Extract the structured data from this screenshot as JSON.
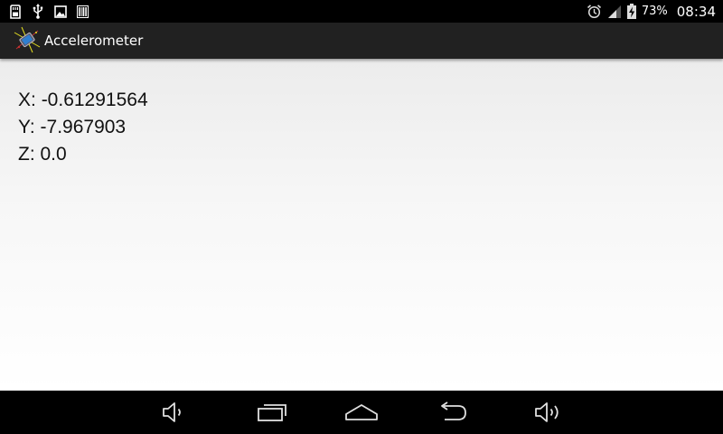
{
  "status_bar": {
    "left_icons": [
      "sd-card-icon",
      "usb-icon",
      "image-icon",
      "barcode-icon"
    ],
    "battery_percent": "73%",
    "time": "08:34"
  },
  "app": {
    "title": "Accelerometer"
  },
  "readings": [
    {
      "label": "X: ",
      "value": "-0.61291564"
    },
    {
      "label": "Y: ",
      "value": "-7.967903"
    },
    {
      "label": "Z: ",
      "value": "0.0"
    }
  ],
  "navigation": {
    "buttons": [
      "volume-down",
      "recent-apps",
      "home",
      "back",
      "volume-up"
    ]
  },
  "colors": {
    "status_bar": "#000000",
    "action_bar": "#212121",
    "text": "#111111",
    "icon": "#e0e0e0"
  }
}
